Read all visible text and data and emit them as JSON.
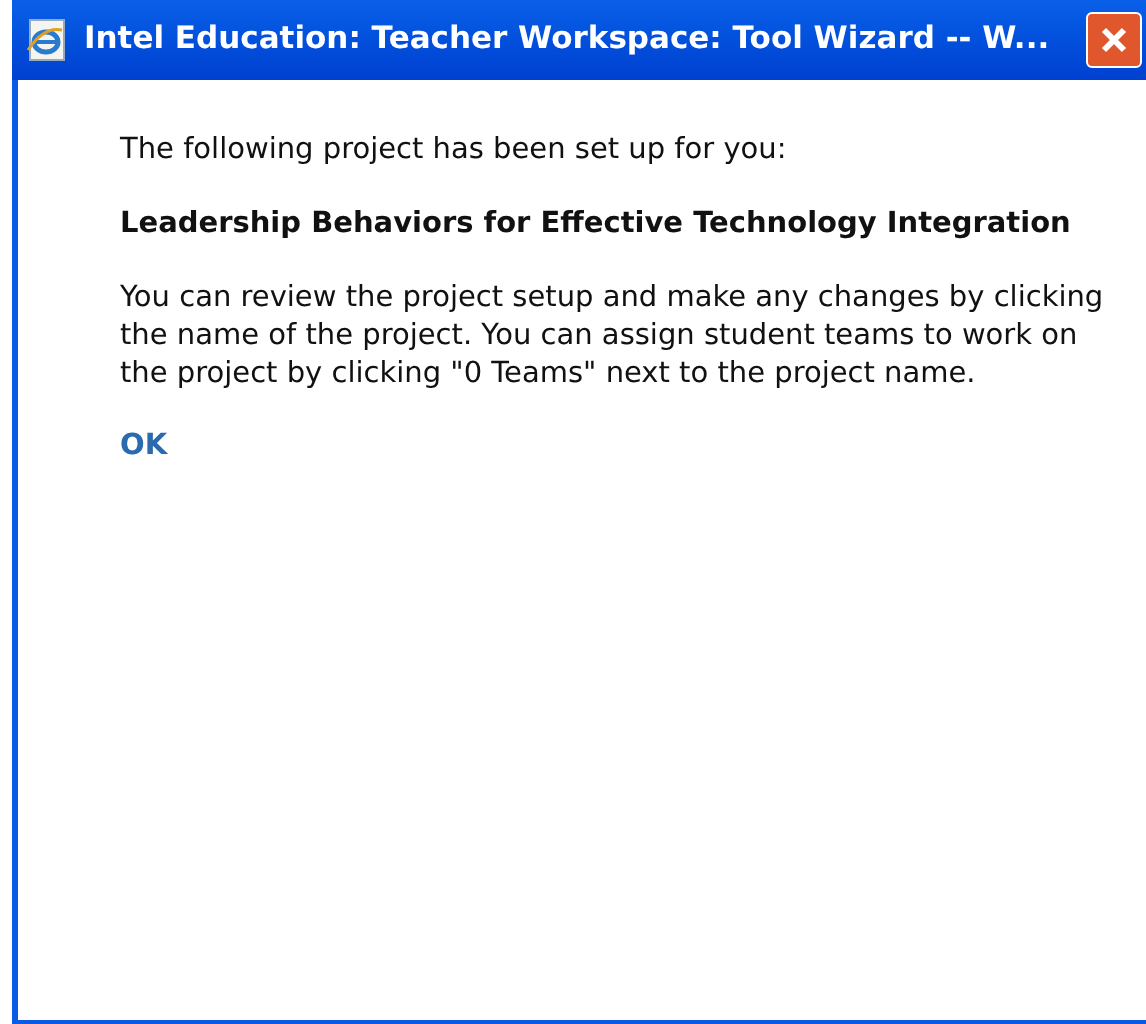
{
  "window": {
    "title": "Intel Education: Teacher Workspace: Tool Wizard -- W..."
  },
  "intro": "The following project has been set up for you:",
  "project_name": "Leadership Behaviors for Effective Technology Integration",
  "message": "You can review the project setup and make any changes by clicking the name of the project. You can assign student teams to work on the project by clicking \"0 Teams\" next to the project name.",
  "ok_link": "OK"
}
